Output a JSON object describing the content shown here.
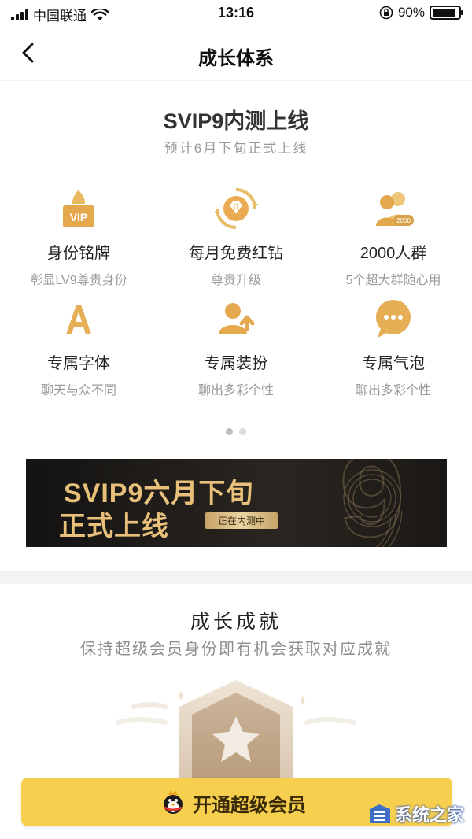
{
  "status_bar": {
    "carrier": "中国联通",
    "time": "13:16",
    "battery": "90%",
    "battery_level": 0.9
  },
  "nav": {
    "title": "成长体系"
  },
  "hero": {
    "title": "SVIP9内测上线",
    "subtitle": "预计6月下旬正式上线"
  },
  "features": [
    {
      "icon": "vip-nameplate-icon",
      "name": "身份铭牌",
      "desc": "彰显LV9尊贵身份"
    },
    {
      "icon": "red-diamond-icon",
      "name": "每月免费红钻",
      "desc": "尊贵升级"
    },
    {
      "icon": "group-2000-icon",
      "name": "2000人群",
      "desc": "5个超大群随心用"
    },
    {
      "icon": "font-a-icon",
      "name": "专属字体",
      "desc": "聊天与众不同"
    },
    {
      "icon": "dress-up-icon",
      "name": "专属装扮",
      "desc": "聊出多彩个性"
    },
    {
      "icon": "chat-bubble-icon",
      "name": "专属气泡",
      "desc": "聊出多彩个性"
    }
  ],
  "carousel": {
    "pages": 2,
    "active": 0
  },
  "banner": {
    "line1": "SVIP9六月下旬",
    "line2": "正式上线",
    "tag": "正在内测中",
    "badge_text": "9",
    "red_icon_text": "红",
    "group_badge_text": "2000"
  },
  "achievements": {
    "title": "成长成就",
    "subtitle": "保持超级会员身份即有机会获取对应成就"
  },
  "cta": {
    "label": "开通超级会员"
  },
  "watermark": {
    "text": "系统之家"
  },
  "colors": {
    "gold": "#e0ae54",
    "cta_bg": "#f6cf4f",
    "banner_bg": "#1c1a18"
  }
}
